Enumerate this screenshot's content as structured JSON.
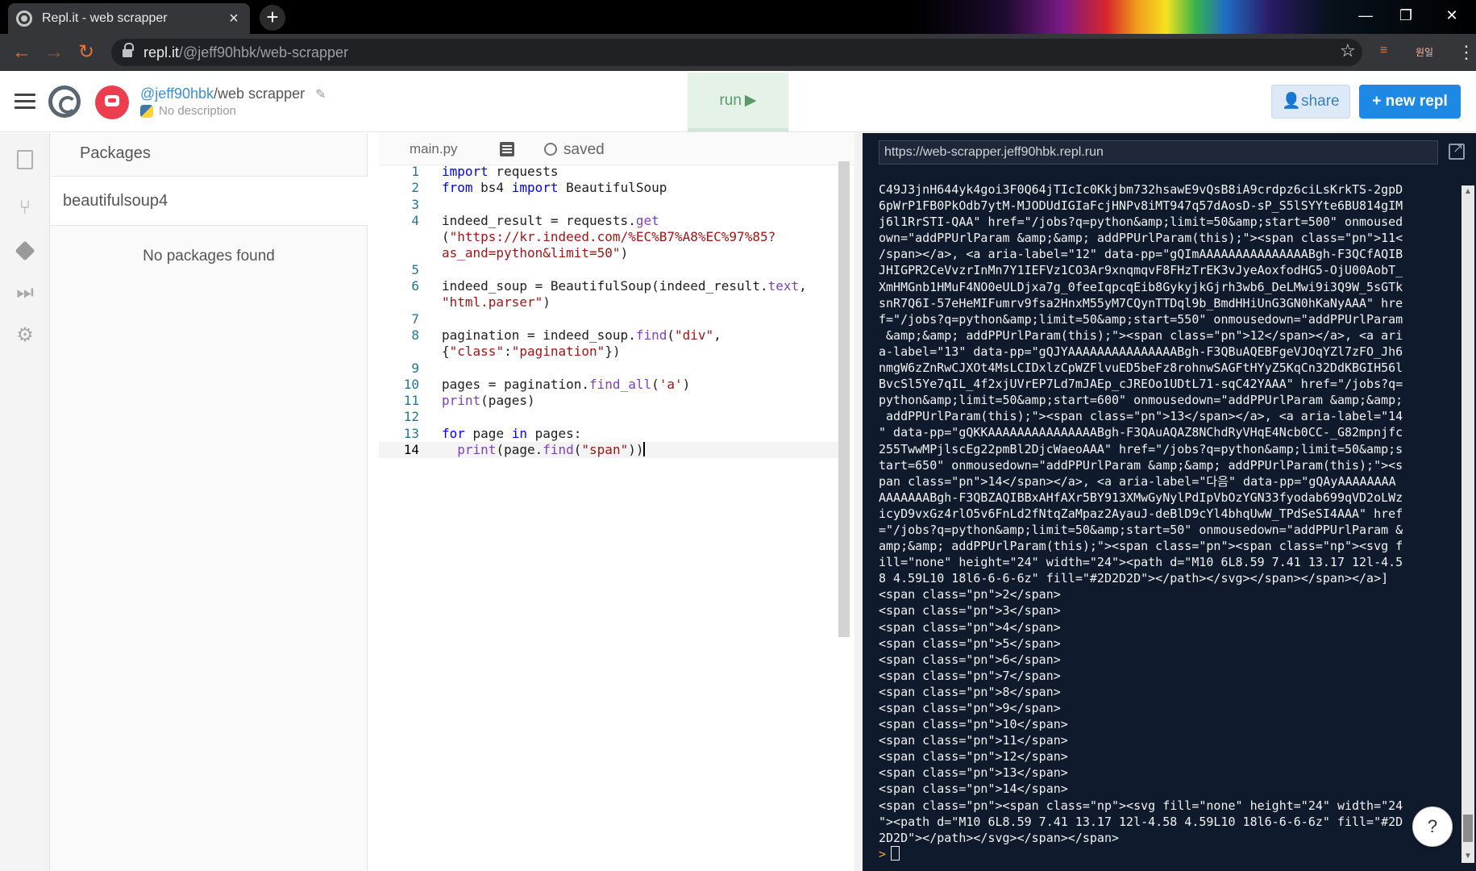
{
  "browser": {
    "tab_title": "Repl.it - web scrapper",
    "tab_close": "×",
    "new_tab": "+",
    "url_host": "repl.it",
    "url_path": "/@jeff90hbk/web-scrapper",
    "minimize": "—",
    "restore": "❐",
    "close": "✕",
    "ext_label": "원일"
  },
  "header": {
    "username": "@jeff90hbk",
    "separator": "/",
    "repl_name": "web scrapper",
    "description": "No description",
    "run_label": "run",
    "share_label": "share",
    "new_repl_label": "+ new repl"
  },
  "packages": {
    "title": "Packages",
    "search_value": "beautifulsoup4",
    "empty_text": "No packages found"
  },
  "editor": {
    "file_name": "main.py",
    "status": "saved"
  },
  "console": {
    "url": "https://web-scrapper.jeff90hbk.repl.run",
    "prompt": ">",
    "help": "?"
  },
  "colors": {
    "accent_blue": "#1e88e5",
    "console_bg": "#0f1a2c",
    "run_green": "#e4f2e8"
  }
}
